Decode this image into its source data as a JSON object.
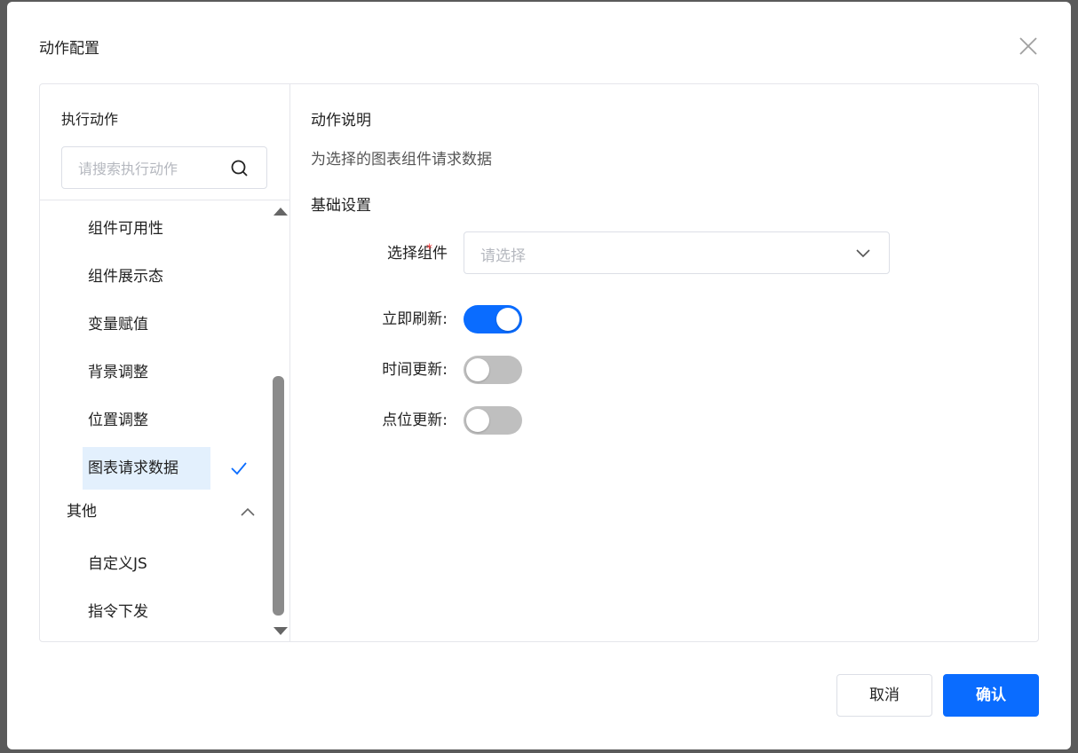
{
  "dialog": {
    "title": "动作配置",
    "cancel_label": "取消",
    "confirm_label": "确认"
  },
  "left": {
    "title": "执行动作",
    "search_placeholder": "请搜索执行动作",
    "items": [
      {
        "label": "组件可用性"
      },
      {
        "label": "组件展示态"
      },
      {
        "label": "变量赋值"
      },
      {
        "label": "背景调整"
      },
      {
        "label": "位置调整"
      },
      {
        "label": "图表请求数据",
        "selected": true
      }
    ],
    "group": {
      "title": "其他",
      "expanded": true,
      "items": [
        {
          "label": "自定义JS"
        },
        {
          "label": "指令下发"
        }
      ]
    }
  },
  "right": {
    "desc_title": "动作说明",
    "desc_text": "为选择的图表组件请求数据",
    "basic_title": "基础设置",
    "select_label": "选择组件",
    "select_placeholder": "请选择",
    "toggles": [
      {
        "label": "立即刷新:",
        "on": true
      },
      {
        "label": "时间更新:",
        "on": false
      },
      {
        "label": "点位更新:",
        "on": false
      }
    ]
  },
  "colors": {
    "primary": "#0a6cff",
    "selected_bg": "#e3f0fd",
    "required": "#f53f3f"
  }
}
